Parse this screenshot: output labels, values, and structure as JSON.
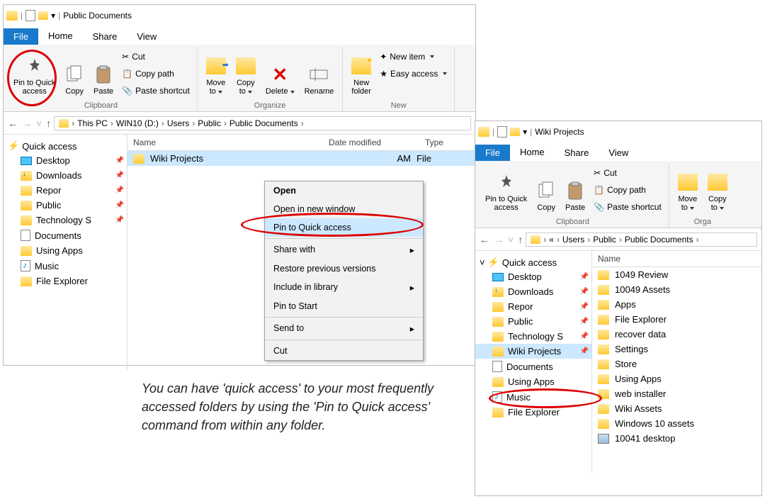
{
  "w1": {
    "title": "Public Documents",
    "tabs": {
      "file": "File",
      "home": "Home",
      "share": "Share",
      "view": "View"
    },
    "ribbon": {
      "pin": "Pin to Quick\naccess",
      "copy": "Copy",
      "paste": "Paste",
      "cut": "Cut",
      "copy_path": "Copy path",
      "paste_shortcut": "Paste shortcut",
      "clipboard": "Clipboard",
      "move_to": "Move\nto",
      "copy_to": "Copy\nto",
      "delete": "Delete",
      "rename": "Rename",
      "organize": "Organize",
      "new_folder": "New\nfolder",
      "new_item": "New item",
      "easy_access": "Easy access",
      "new": "New"
    },
    "breadcrumb": [
      "This PC",
      "WIN10 (D:)",
      "Users",
      "Public",
      "Public Documents"
    ],
    "nav": {
      "header": "Quick access",
      "items": [
        {
          "label": "Desktop",
          "pinned": true,
          "type": "desktop"
        },
        {
          "label": "Downloads",
          "pinned": true,
          "type": "downloads"
        },
        {
          "label": "Repor",
          "pinned": true,
          "type": "folder"
        },
        {
          "label": "Public",
          "pinned": true,
          "type": "folder"
        },
        {
          "label": "Technology S",
          "pinned": true,
          "type": "folder"
        },
        {
          "label": "Documents",
          "pinned": false,
          "type": "doc"
        },
        {
          "label": "Using Apps",
          "pinned": false,
          "type": "folder"
        },
        {
          "label": "Music",
          "pinned": false,
          "type": "music"
        },
        {
          "label": "File Explorer",
          "pinned": false,
          "type": "folder"
        }
      ]
    },
    "cols": [
      "Name",
      "Date modified",
      "Type"
    ],
    "rows": [
      {
        "name": "Wiki Projects",
        "date": "AM",
        "type": "File"
      }
    ],
    "ctx": [
      "Open",
      "Open in new window",
      "Pin to Quick access",
      "—",
      "Share with",
      "Restore previous versions",
      "Include in library",
      "Pin to Start",
      "—",
      "Send to",
      "—",
      "Cut"
    ]
  },
  "w2": {
    "title": "Wiki Projects",
    "tabs": {
      "file": "File",
      "home": "Home",
      "share": "Share",
      "view": "View"
    },
    "ribbon": {
      "pin": "Pin to Quick\naccess",
      "copy": "Copy",
      "paste": "Paste",
      "cut": "Cut",
      "copy_path": "Copy path",
      "paste_shortcut": "Paste shortcut",
      "clipboard": "Clipboard",
      "move_to": "Move\nto",
      "copy_to": "Copy\nto",
      "organize": "Orga"
    },
    "breadcrumb": [
      "«",
      "Users",
      "Public",
      "Public Documents"
    ],
    "nav": {
      "header": "Quick access",
      "items": [
        {
          "label": "Desktop",
          "pinned": true,
          "type": "desktop"
        },
        {
          "label": "Downloads",
          "pinned": true,
          "type": "downloads"
        },
        {
          "label": "Repor",
          "pinned": true,
          "type": "folder"
        },
        {
          "label": "Public",
          "pinned": true,
          "type": "folder"
        },
        {
          "label": "Technology S",
          "pinned": true,
          "type": "folder"
        },
        {
          "label": "Wiki Projects",
          "pinned": true,
          "type": "folder",
          "sel": true
        },
        {
          "label": "Documents",
          "pinned": false,
          "type": "doc"
        },
        {
          "label": "Using Apps",
          "pinned": false,
          "type": "folder"
        },
        {
          "label": "Music",
          "pinned": false,
          "type": "music"
        },
        {
          "label": "File Explorer",
          "pinned": false,
          "type": "folder"
        }
      ]
    },
    "cols": [
      "Name"
    ],
    "files": [
      "1049 Review",
      "10049 Assets",
      "Apps",
      "File Explorer",
      "recover data",
      "Settings",
      "Store",
      "Using Apps",
      "web installer",
      "Wiki Assets",
      "Windows 10 assets",
      "10041 desktop"
    ]
  },
  "caption": "You can have 'quick access' to your most frequently accessed folders by using the 'Pin to Quick access' command from within any folder."
}
